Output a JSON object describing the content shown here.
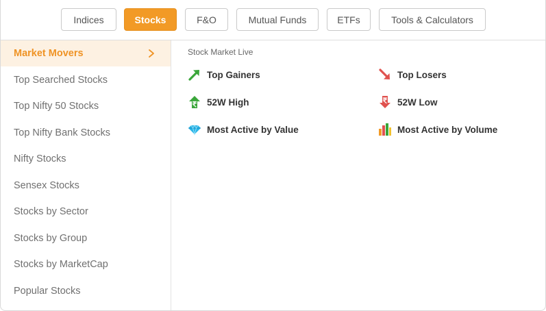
{
  "tabs": [
    {
      "label": "Indices",
      "active": false
    },
    {
      "label": "Stocks",
      "active": true
    },
    {
      "label": "F&O",
      "active": false
    },
    {
      "label": "Mutual Funds",
      "active": false
    },
    {
      "label": "ETFs",
      "active": false
    },
    {
      "label": "Tools & Calculators",
      "active": false
    }
  ],
  "sidebar": {
    "items": [
      {
        "label": "Market Movers",
        "active": true
      },
      {
        "label": "Top Searched Stocks"
      },
      {
        "label": "Top Nifty 50 Stocks"
      },
      {
        "label": "Top Nifty Bank Stocks"
      },
      {
        "label": "Nifty Stocks"
      },
      {
        "label": "Sensex Stocks"
      },
      {
        "label": "Stocks by Sector"
      },
      {
        "label": "Stocks by Group"
      },
      {
        "label": "Stocks by MarketCap"
      },
      {
        "label": "Popular Stocks"
      }
    ]
  },
  "content": {
    "title": "Stock Market Live",
    "links": [
      {
        "label": "Top Gainers",
        "icon": "trend-up-arrow-icon"
      },
      {
        "label": "Top Losers",
        "icon": "trend-down-arrow-icon"
      },
      {
        "label": "52W High",
        "icon": "rupee-up-icon"
      },
      {
        "label": "52W Low",
        "icon": "rupee-down-icon"
      },
      {
        "label": "Most Active by Value",
        "icon": "diamond-icon"
      },
      {
        "label": "Most Active by Volume",
        "icon": "bar-chart-icon"
      }
    ]
  },
  "colors": {
    "accent": "#f29a26",
    "active_bg": "#fdf1e2",
    "up": "#3aa63a",
    "down": "#e0524f"
  }
}
